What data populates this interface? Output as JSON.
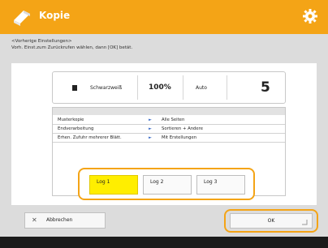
{
  "header": {
    "title": "Kopie",
    "app_icon": "copy-app-icon",
    "settings_icon": "gear-icon",
    "accent_color": "#f4a416"
  },
  "hint": {
    "line1": "<Vorherige Einstellungen>",
    "line2": "Vorh. Einst.zum Zurückrufen wählen, dann [OK] betät."
  },
  "status": {
    "color_mode": "Schwarzweiß",
    "zoom": "100%",
    "paper": "Auto",
    "copies": "5",
    "color_icon": "black-square-icon"
  },
  "settings_list": [
    {
      "key": "Musterkopie",
      "value": "Alle Seiten"
    },
    {
      "key": "Endverarbeitung",
      "value": "Sortieren + Andere"
    },
    {
      "key": "Erhen. Zufuhr mehrerer Blätt.",
      "value": "Mit Erstellungen"
    }
  ],
  "memory": {
    "selected": "Log 1",
    "items": [
      "Log 1",
      "Log 2",
      "Log 3"
    ]
  },
  "footer": {
    "cancel_label": "Abbrechen",
    "ok_label": "OK"
  }
}
